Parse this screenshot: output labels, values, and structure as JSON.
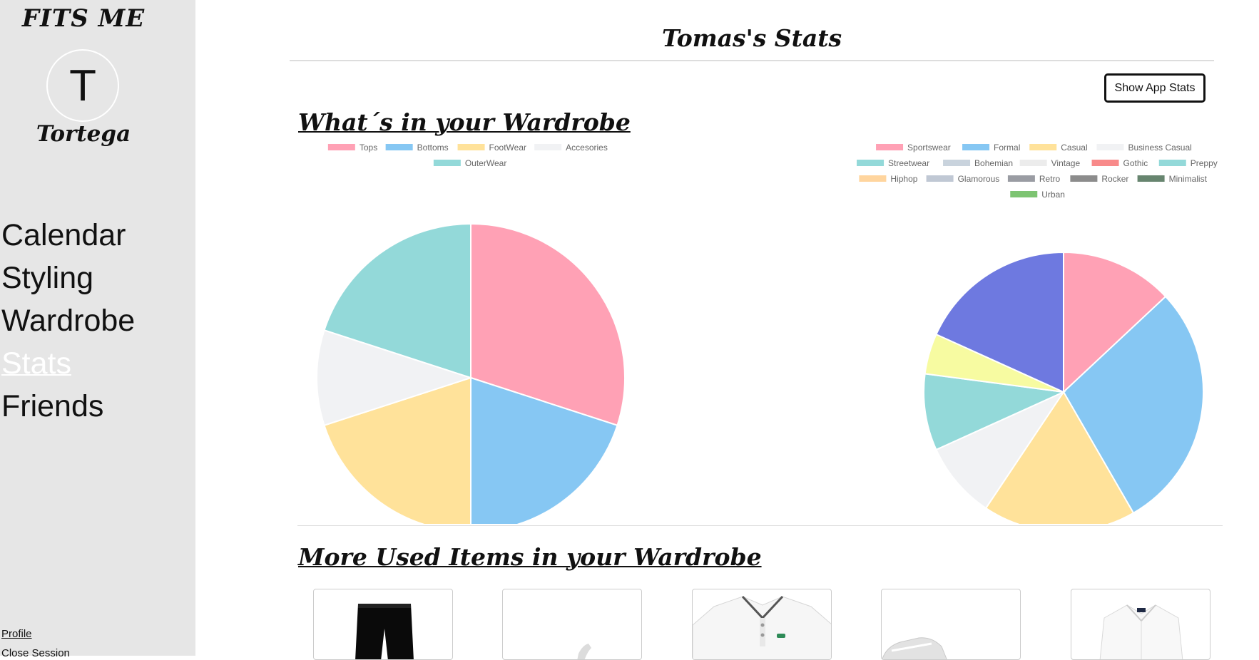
{
  "sidebar": {
    "brand": "FITS ME",
    "avatar_initial": "T",
    "username": "Tortega",
    "nav": [
      {
        "label": "Calendar",
        "active": false
      },
      {
        "label": "Styling",
        "active": false
      },
      {
        "label": "Wardrobe",
        "active": false
      },
      {
        "label": "Stats",
        "active": true
      },
      {
        "label": "Friends",
        "active": false
      }
    ],
    "profile_label": "Profile",
    "close_label": "Close Session"
  },
  "main": {
    "title": "Tomas's Stats",
    "app_stats_button": "Show App Stats",
    "section_wardrobe": "What´s in your Wardrobe",
    "section_items": "More Used Items in your Wardrobe"
  },
  "chart_data": [
    {
      "type": "pie",
      "title": "",
      "labels": [
        "Tops",
        "Bottoms",
        "FootWear",
        "Accesories",
        "OuterWear"
      ],
      "values": [
        30,
        20,
        20,
        10,
        20
      ],
      "colors": [
        "#ffa1b5",
        "#86c7f3",
        "#ffe29a",
        "#f1f2f4",
        "#93d9d9"
      ],
      "legend": "top"
    },
    {
      "type": "pie",
      "title": "",
      "labels": [
        "Sportswear",
        "Formal",
        "Casual",
        "Business Casual",
        "Streetwear",
        "Bohemian",
        "Vintage",
        "Gothic",
        "Preppy",
        "Hiphop",
        "Glamorous",
        "Retro",
        "Rocker",
        "Minimalist",
        "Urban"
      ],
      "values": [
        12.5,
        27.5,
        17,
        8.5,
        0,
        0,
        0,
        0,
        8.5,
        0,
        0,
        0,
        0,
        0,
        0
      ],
      "extra_slices": [
        {
          "value": 4.5,
          "color": "#f7fba1"
        },
        {
          "value": 17.5,
          "color": "#6e79e0"
        }
      ],
      "colors": [
        "#ffa1b5",
        "#86c7f3",
        "#ffe29a",
        "#f1f2f4",
        "#93d9d9",
        "#c9d3dd",
        "#ececec",
        "#f88a8a",
        "#93d9d9",
        "#ffd59e",
        "#c0c8d4",
        "#9a9ca3",
        "#8c8c8c",
        "#67856f",
        "#7dc472"
      ],
      "legend": "top"
    }
  ],
  "items": [
    {
      "name": "black pants",
      "icon": "pants-icon"
    },
    {
      "name": "white sneaker",
      "icon": "sneaker-icon"
    },
    {
      "name": "white polo",
      "icon": "polo-icon"
    },
    {
      "name": "white sneakers",
      "icon": "sneakers-icon"
    },
    {
      "name": "white shirt",
      "icon": "shirt-icon"
    }
  ]
}
